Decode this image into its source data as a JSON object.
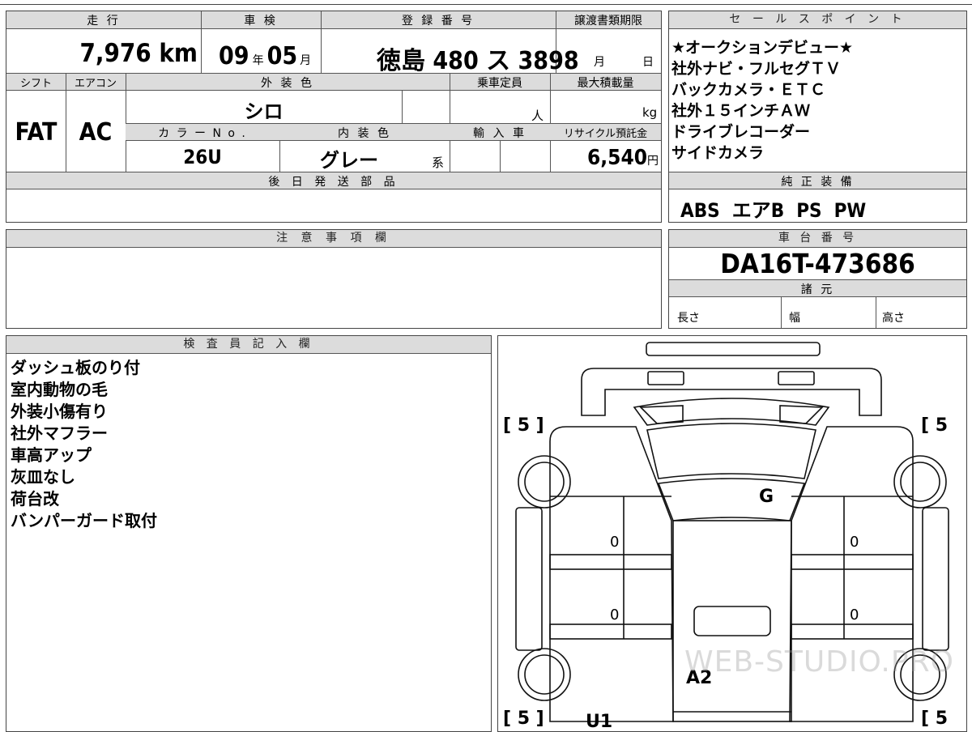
{
  "top": {
    "mileage_label": "走 行",
    "mileage_value": "7,976 km",
    "inspection_label": "車 検",
    "inspection_year": "09",
    "inspection_year_unit": "年",
    "inspection_month": "05",
    "inspection_month_unit": "月",
    "registration_label": "登 録 番 号",
    "registration_value": "徳島 480 ス 3898",
    "transfer_label": "譲渡書類期限",
    "transfer_month_unit": "月",
    "transfer_day_unit": "日",
    "sales_label": "セ ー ル ス ポ イ ン ト"
  },
  "mid": {
    "shift_label": "シフト",
    "shift_value": "FAT",
    "aircon_label": "エアコン",
    "aircon_value": "AC",
    "exterior_label": "外 装 色",
    "exterior_value": "シロ",
    "capacity_label": "乗車定員",
    "capacity_unit": "人",
    "maxload_label": "最大積載量",
    "maxload_unit": "kg",
    "color_no_label": "カ ラ ー N o .",
    "color_no_value": "26U",
    "interior_label": "内 装 色",
    "interior_value": "グレー",
    "interior_suffix": "系",
    "import_label": "輸 入 車",
    "recycle_label": "リサイクル預託金",
    "recycle_value": "6,540",
    "recycle_unit": "円",
    "later_parts_label": "後 日 発 送 部 品"
  },
  "sales_points": [
    "★オークションデビュー★",
    "社外ナビ・フルセグＴＶ",
    "バックカメラ・ＥＴＣ",
    "社外１５インチＡＷ",
    "ドライブレコーダー",
    "サイドカメラ"
  ],
  "genuine": {
    "label": "純 正 装 備",
    "value": "ABS  エアB  PS  PW"
  },
  "notes": {
    "label": "注 意 事 項 欄"
  },
  "chassis": {
    "label": "車 台 番 号",
    "value": "DA16T-473686",
    "spec_label": "諸 元",
    "length": "長さ",
    "width": "幅",
    "height": "高さ"
  },
  "inspector": {
    "label": "検 査 員 記 入 欄",
    "lines": [
      "ダッシュ板のり付",
      "室内動物の毛",
      "外装小傷有り",
      "社外マフラー",
      "車高アップ",
      "灰皿なし",
      "荷台改",
      "バンパーガード取付"
    ]
  },
  "diagram": {
    "tl": "[ 5 ]",
    "tr": "[ 5",
    "bl": "[ 5 ]",
    "br": "[ 5",
    "g": "G",
    "a2": "A2",
    "u1": "U1",
    "z1": "0",
    "z2": "0",
    "z3": "0",
    "z4": "0",
    "watermark": "WEB-STUDIO.PRO"
  }
}
